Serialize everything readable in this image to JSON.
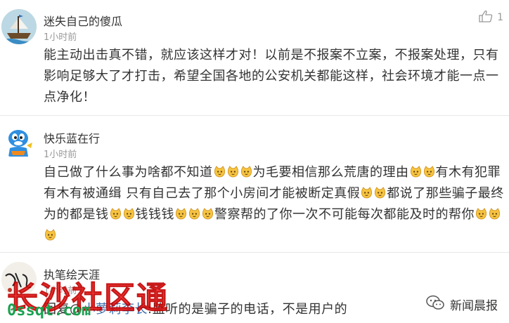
{
  "comments": [
    {
      "username": "迷失自己的傻瓜",
      "time": "1小时前",
      "like_count": "1",
      "text": "能主动出击真不错，就应该这样才对！以前是不报案不立案，不报案处理，只有影响足够大了才打击，希望全国各地的公安机关都能这样，社会环境才能一点一点净化！",
      "avatar_icon": "ship-avatar-icon"
    },
    {
      "username": "快乐蓝在行",
      "time": "1小时前",
      "text_segments": [
        "自己做了什么事为啥都不知道",
        "为毛要相信那么荒唐的理由",
        "有木有犯罪有木有被通缉 只有自己去了那个小房间才能被断定真假",
        "都说了那些骗子最终为的都是钱",
        "钱钱钱",
        "警察帮的了你一次不可能每次都能及时的帮你"
      ],
      "emoji_name": "cat-face-emoji",
      "avatar_icon": "blue-cartoon-avatar-icon"
    },
    {
      "username": "执笔绘天涯",
      "time": "1小时前",
      "reply_prefix": "回复@",
      "reply_user": "小萝莉李长",
      "reply_text": ":监听的是骗子的电话，不是用户的",
      "avatar_icon": "calligraphy-avatar-icon"
    }
  ],
  "watermark": {
    "title": "长沙社区通",
    "url": "0ssqt.com"
  },
  "brand": {
    "name": "新闻晨报",
    "icon": "wechat-icon"
  },
  "colors": {
    "text": "#333333",
    "meta": "#999999",
    "divider": "#e8e8e8",
    "watermark_red": "#ff2a2a",
    "watermark_green": "#1aa14f"
  }
}
